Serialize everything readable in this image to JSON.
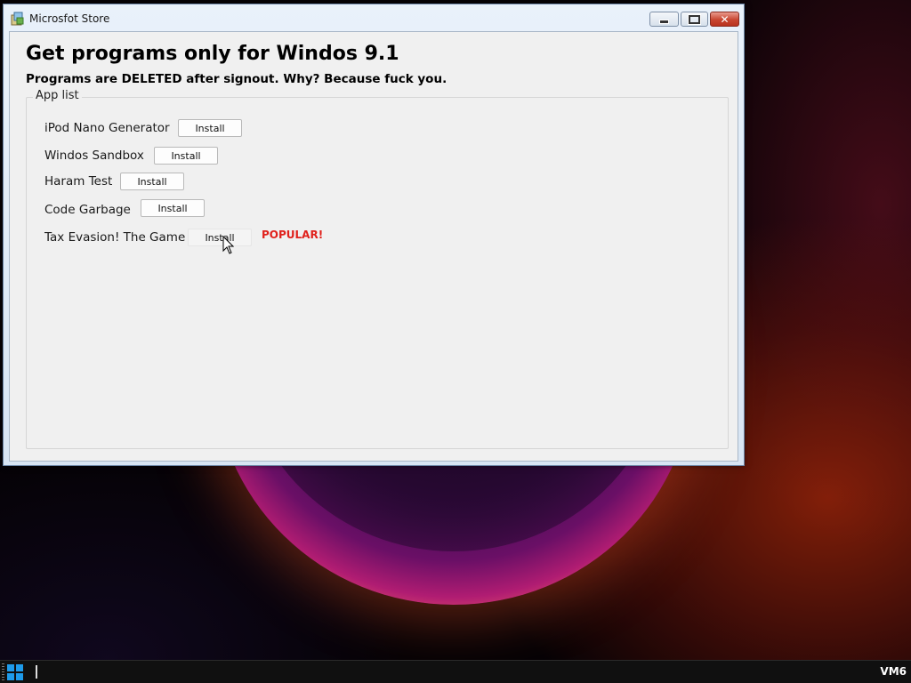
{
  "window": {
    "title": "Microsfot Store",
    "caption": {
      "minimize_icon": "minimize-icon",
      "maximize_icon": "maximize-icon",
      "close_glyph": "✕"
    }
  },
  "main": {
    "heading": "Get programs only for Windos 9.1",
    "subheading": "Programs are DELETED after signout. Why? Because fuck you.",
    "group_label": "App list",
    "apps": [
      {
        "name": "iPod Nano Generator",
        "button": "Install"
      },
      {
        "name": "Windos Sandbox",
        "button": "Install"
      },
      {
        "name": "Haram Test",
        "button": "Install"
      },
      {
        "name": "Code Garbage",
        "button": "Install"
      },
      {
        "name": "Tax Evasion! The Game",
        "button": "Install",
        "badge": "POPULAR!"
      }
    ]
  },
  "taskbar": {
    "start_icon": "windows-logo-icon",
    "vm_label": "VM6"
  },
  "colors": {
    "badge": "#e0201b",
    "close_button": "#c84631",
    "start_logo": "#1e9bea"
  }
}
